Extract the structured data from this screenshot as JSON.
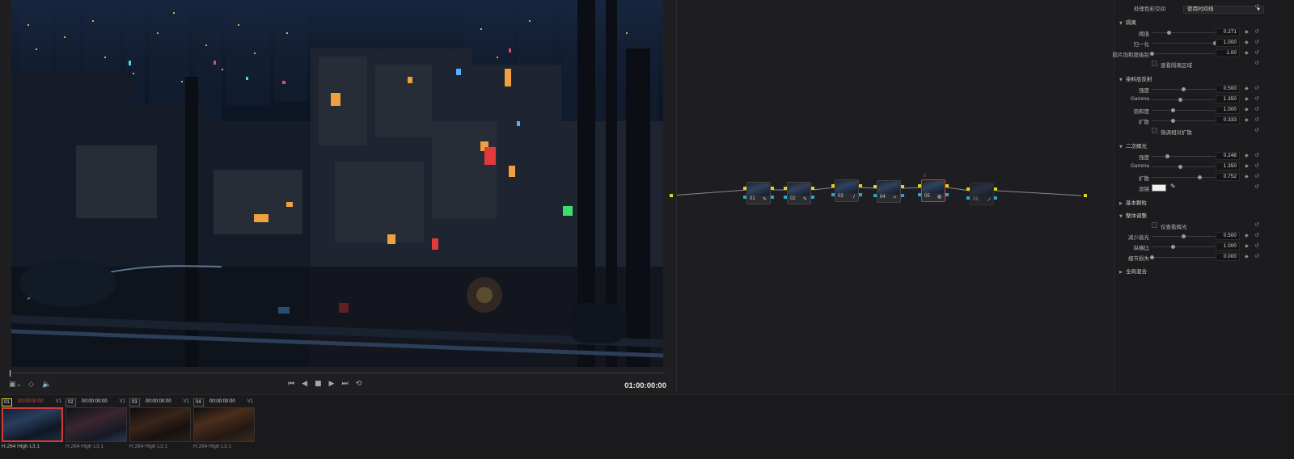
{
  "viewer": {
    "timecode": "01:00:00:00",
    "playhead_fraction": 0.0
  },
  "colors": {
    "accent_red": "#d23a3a",
    "node_input": "#d6d622",
    "node_output": "#2aa4d6",
    "timecode_active": "#e24a3a"
  },
  "nodes": [
    {
      "label": "01",
      "icon": "pencil-icon",
      "glyph": "✎"
    },
    {
      "label": "02",
      "icon": "pencil-icon",
      "glyph": "✎"
    },
    {
      "label": "03",
      "icon": "curve-icon",
      "glyph": "∕"
    },
    {
      "label": "04",
      "icon": "effects-icon",
      "glyph": "✧"
    },
    {
      "label": "05",
      "icon": "glow-icon",
      "glyph": "◍",
      "selected": true
    },
    {
      "label": "06",
      "icon": "layer-icon",
      "glyph": "⁄⁄",
      "disabled": true
    }
  ],
  "selected_node_marker": "5",
  "inspector": {
    "color_space_label": "处理色彩空间",
    "color_space_value": "使用时间线",
    "sections": {
      "isolate": "隔离",
      "hotspot": "染料层反射",
      "secondary": "二次辉光",
      "basic_grain": "基本颗粒",
      "overall": "整体调整",
      "global_blend": "全局混合"
    },
    "isolate": {
      "threshold": {
        "label": "阈值",
        "value": "0.271",
        "fraction": 0.271
      },
      "normalize": {
        "label": "归一化",
        "value": "1.000",
        "fraction": 1.0
      },
      "film_black": {
        "label": "胶片饱和度级别",
        "value": "1.00",
        "fraction": 0.0
      },
      "show_isolated": "查看隔离区域"
    },
    "hotspot": {
      "strength": {
        "label": "强度",
        "value": "0.500",
        "fraction": 0.5
      },
      "gamma": {
        "label": "Gamma",
        "value": "1.350",
        "fraction": 0.45
      },
      "saturation": {
        "label": "饱和度",
        "value": "1.000",
        "fraction": 0.33
      },
      "spread": {
        "label": "扩散",
        "value": "0.333",
        "fraction": 0.333
      },
      "relative_spread": "微调相对扩散"
    },
    "secondary": {
      "strength": {
        "label": "强度",
        "value": "0.248",
        "fraction": 0.248
      },
      "gamma": {
        "label": "Gamma",
        "value": "1.350",
        "fraction": 0.45
      },
      "spread": {
        "label": "扩散",
        "value": "0.752",
        "fraction": 0.752
      },
      "filter_label": "滤镜"
    },
    "overall": {
      "show_glow_only": "仅查看辉光",
      "reduce_highlights": {
        "label": "减少高光",
        "value": "0.500",
        "fraction": 0.5
      },
      "aspect": {
        "label": "纵横比",
        "value": "1.000",
        "fraction": 0.33
      },
      "detail_loss": {
        "label": "细节损失",
        "value": "0.000",
        "fraction": 0.0
      }
    }
  },
  "clips": [
    {
      "num": "01",
      "timecode": "00:00:00:00",
      "track": "V1",
      "codec": "H.264 High L3.1",
      "active": true
    },
    {
      "num": "02",
      "timecode": "00:00:00:00",
      "track": "V1",
      "codec": "H.264 High L3.1"
    },
    {
      "num": "03",
      "timecode": "00:00:00:00",
      "track": "V1",
      "codec": "H.264 High L3.1"
    },
    {
      "num": "04",
      "timecode": "00:00:00:00",
      "track": "V1",
      "codec": "H.264 High L3.1"
    }
  ]
}
